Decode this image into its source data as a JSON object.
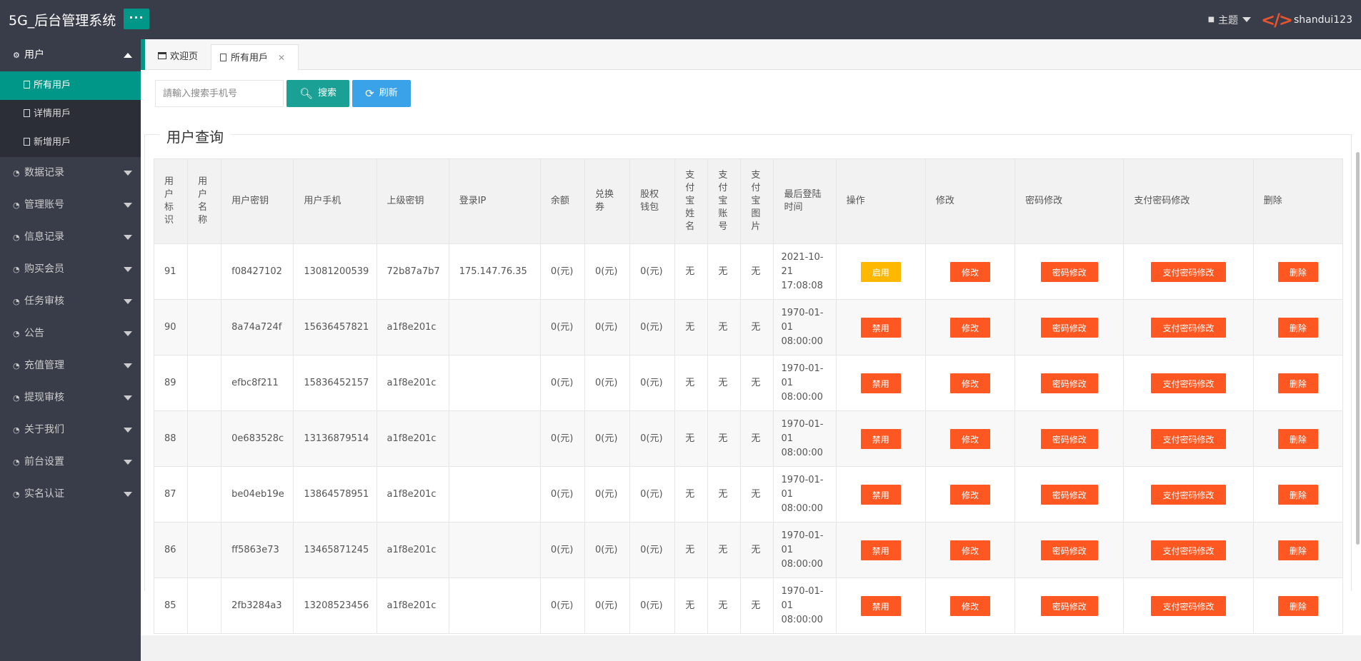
{
  "header": {
    "logo": "5G_后台管理系统",
    "menu_toggle": "···",
    "theme_label": "主题",
    "username": "shandui123"
  },
  "sidebar": {
    "user_group": "用户",
    "sub_items": [
      "所有用戶",
      "详情用戶",
      "新增用戶"
    ],
    "groups": [
      "数据记录",
      "管理账号",
      "信息记录",
      "购买会员",
      "任务审核",
      "公告",
      "充值管理",
      "提现审核",
      "关于我们",
      "前台设置",
      "实名认证"
    ]
  },
  "tabs": {
    "welcome": "欢迎页",
    "active": "所有用戶"
  },
  "toolbar": {
    "search_placeholder": "請輸入搜索手机号",
    "search_label": "搜索",
    "refresh_label": "刷新"
  },
  "section_title": "用户查询",
  "table": {
    "headers": [
      "用户标识",
      "用户名称",
      "用户密钥",
      "用户手机",
      "上级密钥",
      "登录IP",
      "余额",
      "兑换券",
      "股权钱包",
      "支付宝姓名",
      "支付宝账号",
      "支付宝图片",
      "最后登陆时间",
      "操作",
      "修改",
      "密码修改",
      "支付密码修改",
      "删除"
    ],
    "rows": [
      {
        "id": "91",
        "name": "",
        "key": "f08427102",
        "phone": "13081200539",
        "parent": "72b87a7b7",
        "ip": "175.147.76.35",
        "balance": "0(元)",
        "coupon": "0(元)",
        "equity": "0(元)",
        "ali_name": "无",
        "ali_acct": "无",
        "ali_img": "无",
        "last_login": "2021-10-21 17:08:08",
        "status_btn": "启用",
        "status_kind": "enable"
      },
      {
        "id": "90",
        "name": "",
        "key": "8a74a724f",
        "phone": "15636457821",
        "parent": "a1f8e201c",
        "ip": "",
        "balance": "0(元)",
        "coupon": "0(元)",
        "equity": "0(元)",
        "ali_name": "无",
        "ali_acct": "无",
        "ali_img": "无",
        "last_login": "1970-01-01 08:00:00",
        "status_btn": "禁用",
        "status_kind": "disable"
      },
      {
        "id": "89",
        "name": "",
        "key": "efbc8f211",
        "phone": "15836452157",
        "parent": "a1f8e201c",
        "ip": "",
        "balance": "0(元)",
        "coupon": "0(元)",
        "equity": "0(元)",
        "ali_name": "无",
        "ali_acct": "无",
        "ali_img": "无",
        "last_login": "1970-01-01 08:00:00",
        "status_btn": "禁用",
        "status_kind": "disable"
      },
      {
        "id": "88",
        "name": "",
        "key": "0e683528c",
        "phone": "13136879514",
        "parent": "a1f8e201c",
        "ip": "",
        "balance": "0(元)",
        "coupon": "0(元)",
        "equity": "0(元)",
        "ali_name": "无",
        "ali_acct": "无",
        "ali_img": "无",
        "last_login": "1970-01-01 08:00:00",
        "status_btn": "禁用",
        "status_kind": "disable"
      },
      {
        "id": "87",
        "name": "",
        "key": "be04eb19e",
        "phone": "13864578951",
        "parent": "a1f8e201c",
        "ip": "",
        "balance": "0(元)",
        "coupon": "0(元)",
        "equity": "0(元)",
        "ali_name": "无",
        "ali_acct": "无",
        "ali_img": "无",
        "last_login": "1970-01-01 08:00:00",
        "status_btn": "禁用",
        "status_kind": "disable"
      },
      {
        "id": "86",
        "name": "",
        "key": "ff5863e73",
        "phone": "13465871245",
        "parent": "a1f8e201c",
        "ip": "",
        "balance": "0(元)",
        "coupon": "0(元)",
        "equity": "0(元)",
        "ali_name": "无",
        "ali_acct": "无",
        "ali_img": "无",
        "last_login": "1970-01-01 08:00:00",
        "status_btn": "禁用",
        "status_kind": "disable"
      },
      {
        "id": "85",
        "name": "",
        "key": "2fb3284a3",
        "phone": "13208523456",
        "parent": "a1f8e201c",
        "ip": "",
        "balance": "0(元)",
        "coupon": "0(元)",
        "equity": "0(元)",
        "ali_name": "无",
        "ali_acct": "无",
        "ali_img": "无",
        "last_login": "1970-01-01 08:00:00",
        "status_btn": "禁用",
        "status_kind": "disable"
      }
    ],
    "edit_label": "修改",
    "pwd_label": "密码修改",
    "paypwd_label": "支付密码修改",
    "delete_label": "删除"
  }
}
